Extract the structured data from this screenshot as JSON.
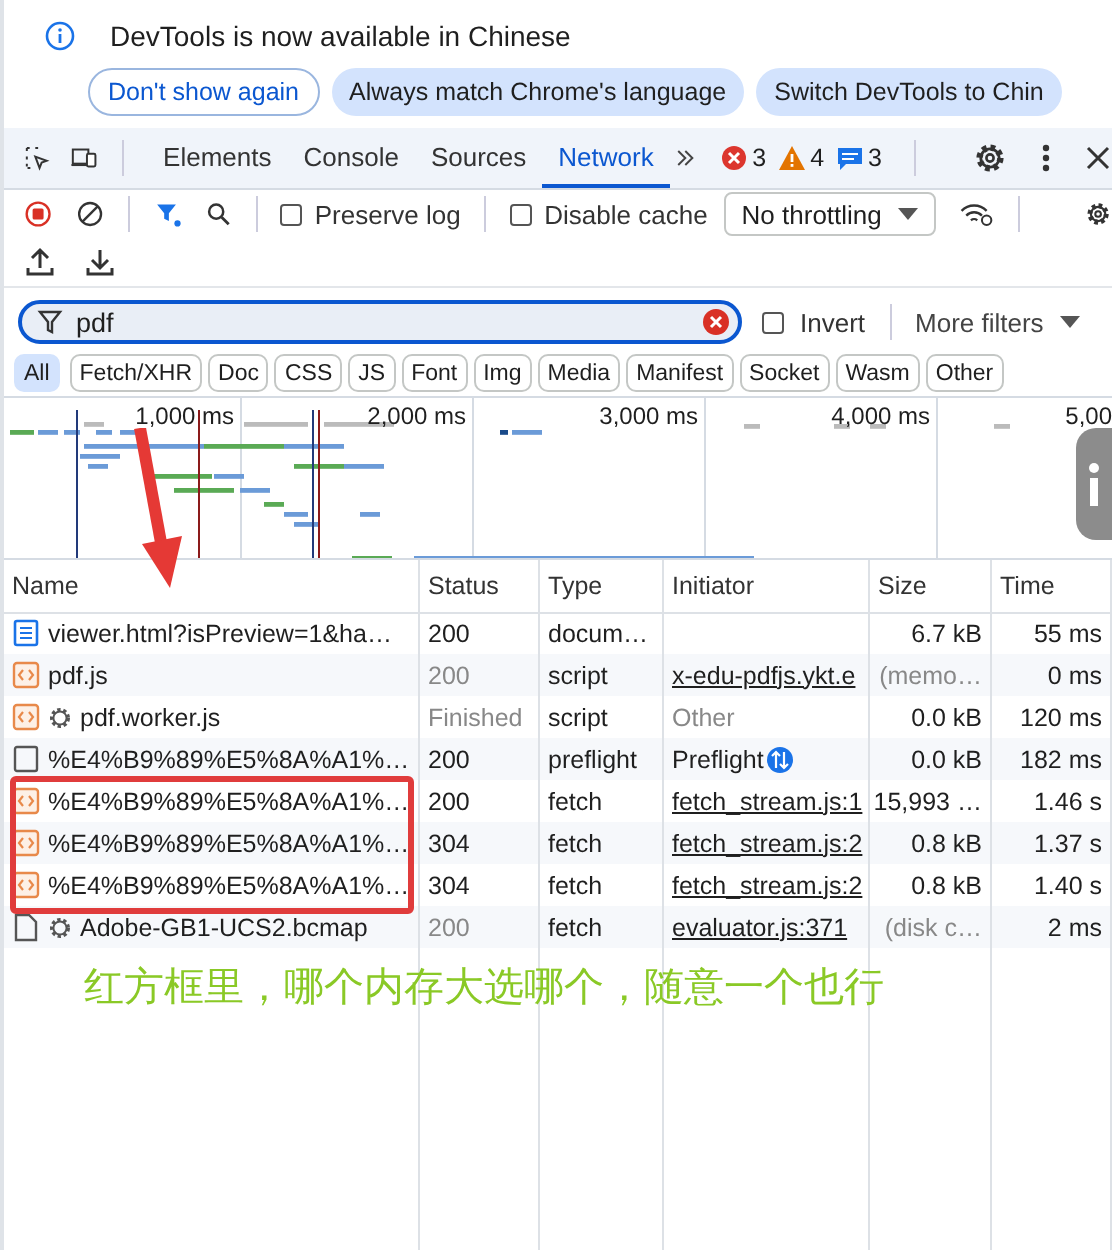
{
  "infobar": {
    "message": "DevTools is now available in Chinese",
    "buttons": [
      {
        "label": "Don't show again",
        "kind": "outline"
      },
      {
        "label": "Always match Chrome's language",
        "kind": "filled"
      },
      {
        "label": "Switch DevTools to Chin",
        "kind": "filled"
      }
    ]
  },
  "tabs": [
    {
      "label": "Elements",
      "selected": false
    },
    {
      "label": "Console",
      "selected": false
    },
    {
      "label": "Sources",
      "selected": false
    },
    {
      "label": "Network",
      "selected": true
    }
  ],
  "issues": {
    "errors": "3",
    "warnings": "4",
    "messages": "3"
  },
  "toolbar": {
    "preserve_log": {
      "label": "Preserve log",
      "checked": false
    },
    "disable_cache": {
      "label": "Disable cache",
      "checked": false
    },
    "throttling": "No throttling"
  },
  "filter": {
    "value": "pdf",
    "invert": {
      "label": "Invert",
      "checked": false
    },
    "more_filters": "More filters"
  },
  "type_filters": [
    {
      "label": "All",
      "selected": true
    },
    {
      "label": "Fetch/XHR",
      "selected": false
    },
    {
      "label": "Doc",
      "selected": false
    },
    {
      "label": "CSS",
      "selected": false
    },
    {
      "label": "JS",
      "selected": false
    },
    {
      "label": "Font",
      "selected": false
    },
    {
      "label": "Img",
      "selected": false
    },
    {
      "label": "Media",
      "selected": false
    },
    {
      "label": "Manifest",
      "selected": false
    },
    {
      "label": "Socket",
      "selected": false
    },
    {
      "label": "Wasm",
      "selected": false
    },
    {
      "label": "Other",
      "selected": false
    }
  ],
  "overview": {
    "ticks": [
      "1,000 ms",
      "2,000 ms",
      "3,000 ms",
      "4,000 ms",
      "5,00"
    ]
  },
  "table": {
    "columns": [
      "Name",
      "Status",
      "Type",
      "Initiator",
      "Size",
      "Time"
    ],
    "rows": [
      {
        "kind": "doc",
        "worker": false,
        "name": "viewer.html?isPreview=1&ha…",
        "status": "200",
        "status_dim": false,
        "type": "docum…",
        "size": "6.7 kB",
        "size_dim": false,
        "time": "55 ms",
        "boxed": false
      },
      {
        "kind": "script",
        "worker": false,
        "name": "pdf.js",
        "status": "200",
        "status_dim": true,
        "type": "script",
        "initiator": "x-edu-pdfjs.ykt.e",
        "initiator_link": true,
        "initiator_dim": false,
        "initiator_icon": false,
        "size": "(memo…",
        "size_dim": true,
        "time": "0 ms",
        "boxed": false
      },
      {
        "kind": "script",
        "worker": true,
        "name": "pdf.worker.js",
        "status": "Finished",
        "status_dim": true,
        "type": "script",
        "initiator": "Other",
        "initiator_link": false,
        "initiator_dim": true,
        "initiator_icon": false,
        "size": "0.0 kB",
        "size_dim": false,
        "time": "120 ms",
        "boxed": false
      },
      {
        "kind": "preflight",
        "worker": false,
        "name": "%E4%B9%89%E5%8A%A1%…",
        "status": "200",
        "status_dim": false,
        "type": "preflight",
        "initiator": "Preflight",
        "initiator_link": false,
        "initiator_dim": false,
        "initiator_icon": true,
        "size": "0.0 kB",
        "size_dim": false,
        "time": "182 ms",
        "boxed": false
      },
      {
        "kind": "script",
        "worker": false,
        "name": "%E4%B9%89%E5%8A%A1%…",
        "status": "200",
        "status_dim": false,
        "type": "fetch",
        "initiator": "fetch_stream.js:1",
        "initiator_link": true,
        "initiator_dim": false,
        "initiator_icon": false,
        "size": "15,993 …",
        "size_dim": false,
        "time": "1.46 s",
        "boxed": true
      },
      {
        "kind": "script",
        "worker": false,
        "name": "%E4%B9%89%E5%8A%A1%…",
        "status": "304",
        "status_dim": false,
        "type": "fetch",
        "initiator": "fetch_stream.js:2",
        "initiator_link": true,
        "initiator_dim": false,
        "initiator_icon": false,
        "size": "0.8 kB",
        "size_dim": false,
        "time": "1.37 s",
        "boxed": true
      },
      {
        "kind": "script",
        "worker": false,
        "name": "%E4%B9%89%E5%8A%A1%…",
        "status": "304",
        "status_dim": false,
        "type": "fetch",
        "initiator": "fetch_stream.js:2",
        "initiator_link": true,
        "initiator_dim": false,
        "initiator_icon": false,
        "size": "0.8 kB",
        "size_dim": false,
        "time": "1.40 s",
        "boxed": true
      },
      {
        "kind": "file",
        "worker": true,
        "name": "Adobe-GB1-UCS2.bcmap",
        "status": "200",
        "status_dim": true,
        "type": "fetch",
        "initiator": "evaluator.js:371",
        "initiator_link": true,
        "initiator_dim": false,
        "initiator_icon": false,
        "size": "(disk c…",
        "size_dim": true,
        "time": "2 ms",
        "boxed": false
      }
    ]
  },
  "note": "红方框里，哪个内存大选哪个，随意一个也行"
}
